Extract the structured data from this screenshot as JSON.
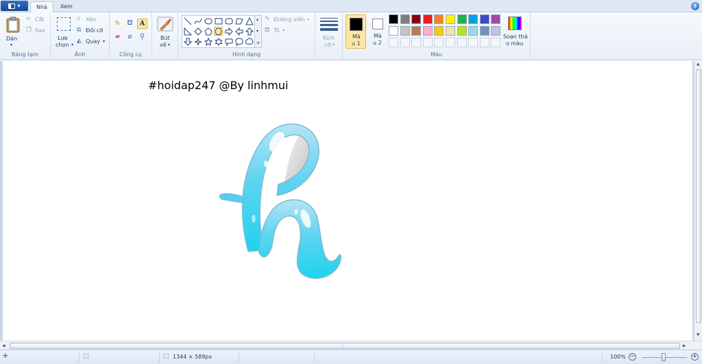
{
  "tabs": [
    {
      "label": "Nhà"
    },
    {
      "label": "Xem"
    }
  ],
  "clipboard": {
    "paste_label": "Dán",
    "cut_label": "Cắt",
    "copy_label": "Sao",
    "group_label": "Bảng tạm"
  },
  "image": {
    "select_label_1": "Lựa",
    "select_label_2": "chọn",
    "crop_label": "Xén",
    "resize_label": "Đổi cỡ",
    "rotate_label": "Quay",
    "group_label": "Ảnh"
  },
  "tools": {
    "group_label": "Công cụ"
  },
  "brushes": {
    "label_1": "Bút",
    "label_2": "vẽ"
  },
  "shapes": {
    "outline_label": "Đường viền",
    "fill_label": "Tô",
    "group_label": "Hình dạng"
  },
  "size": {
    "label_1": "Kích",
    "label_2": "cỡ"
  },
  "colors": {
    "color1_label_1": "Mà",
    "color1_label_2": "u 1",
    "color2_label_1": "Mà",
    "color2_label_2": "u 2",
    "edit_label_1": "Soạn thả",
    "edit_label_2": "o màu",
    "group_label": "Màu",
    "color1_value": "#000000",
    "color2_value": "#ffffff",
    "palette_row1": [
      "#000000",
      "#7f7f7f",
      "#880015",
      "#ed1c24",
      "#ff7f27",
      "#fff200",
      "#22b14c",
      "#00a2e8",
      "#3f48cc",
      "#a349a4"
    ],
    "palette_row2": [
      "#ffffff",
      "#c3c3c3",
      "#b97a57",
      "#ffaec9",
      "#ffc90e",
      "#efe4b0",
      "#b5e61d",
      "#99d9ea",
      "#7092be",
      "#c8bfe7"
    ]
  },
  "canvas": {
    "caption": "#hoidap247 @By linhmui"
  },
  "status": {
    "dimensions": "1344 × 589px",
    "zoom": "100%"
  }
}
